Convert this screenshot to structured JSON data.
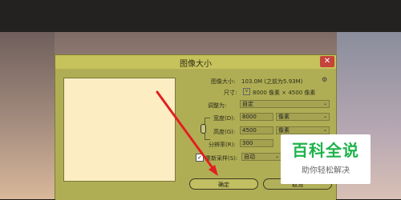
{
  "dialog": {
    "title": "图像大小",
    "close_symbol": "✕",
    "image_size_label": "图像大小:",
    "image_size_value": "103.0M (之前为5.93M)",
    "dimensions_label": "尺寸:",
    "dimensions_value": "8000 像素 × 4500 像素",
    "fit_to_label": "调整为:",
    "fit_to_value": "自定",
    "width_label": "宽度(D):",
    "width_value": "8000",
    "width_unit": "像素",
    "height_label": "高度(G):",
    "height_value": "4500",
    "height_unit": "像素",
    "resolution_label": "分辨率(R):",
    "resolution_value": "300",
    "resample_label": "重新采样(S):",
    "resample_checked": true,
    "resample_value": "自动",
    "ok_label": "确定",
    "cancel_label": "取消"
  },
  "watermark": {
    "title": "百科全说",
    "subtitle": "助你轻松解决"
  },
  "colors": {
    "dialog_bg": "#b0ae55",
    "preview_bg": "#fdedc2",
    "close_button": "#c5433a",
    "annotation_arrow": "#e02020",
    "watermark_green": "#1db34a"
  }
}
